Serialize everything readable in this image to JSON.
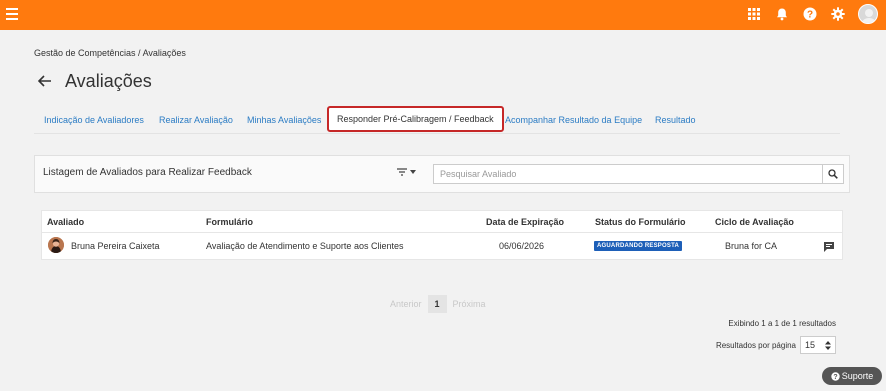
{
  "colors": {
    "topbar": "#ff7a0e",
    "link": "#2b7cc4",
    "highlight_border": "#c62828",
    "badge": "#1d5fb8"
  },
  "topbar": {
    "icons": [
      "apps-grid-icon",
      "bell-icon",
      "help-icon",
      "gear-icon",
      "user-avatar"
    ]
  },
  "breadcrumb": {
    "text": "Gestão de Competências / Avaliações"
  },
  "page": {
    "title": "Avaliações"
  },
  "tabs": [
    {
      "label": "Indicação de Avaliadores"
    },
    {
      "label": "Realizar Avaliação"
    },
    {
      "label": "Minhas Avaliações"
    },
    {
      "label": "Responder Pré-Calibragem / Feedback",
      "highlighted": true
    },
    {
      "label": "Acompanhar Resultado da Equipe"
    },
    {
      "label": "Resultado"
    }
  ],
  "panel": {
    "title": "Listagem de Avaliados para Realizar Feedback",
    "search_placeholder": "Pesquisar Avaliado"
  },
  "table": {
    "headers": {
      "avaliado": "Avaliado",
      "formulario": "Formulário",
      "expiracao": "Data de Expiração",
      "status": "Status do Formulário",
      "ciclo": "Ciclo de Avaliação"
    },
    "rows": [
      {
        "avaliado": "Bruna Pereira Caixeta",
        "formulario": "Avaliação de Atendimento e Suporte aos Clientes",
        "expiracao": "06/06/2026",
        "status": "AGUARDANDO RESPOSTA",
        "ciclo": "Bruna for CA"
      }
    ]
  },
  "pagination": {
    "prev": "Anterior",
    "current": "1",
    "next": "Próxima"
  },
  "results": {
    "info": "Exibindo 1 a 1 de 1 resultados",
    "per_page_label": "Resultados por página",
    "per_page_value": "15"
  },
  "support": {
    "label": "Suporte"
  }
}
